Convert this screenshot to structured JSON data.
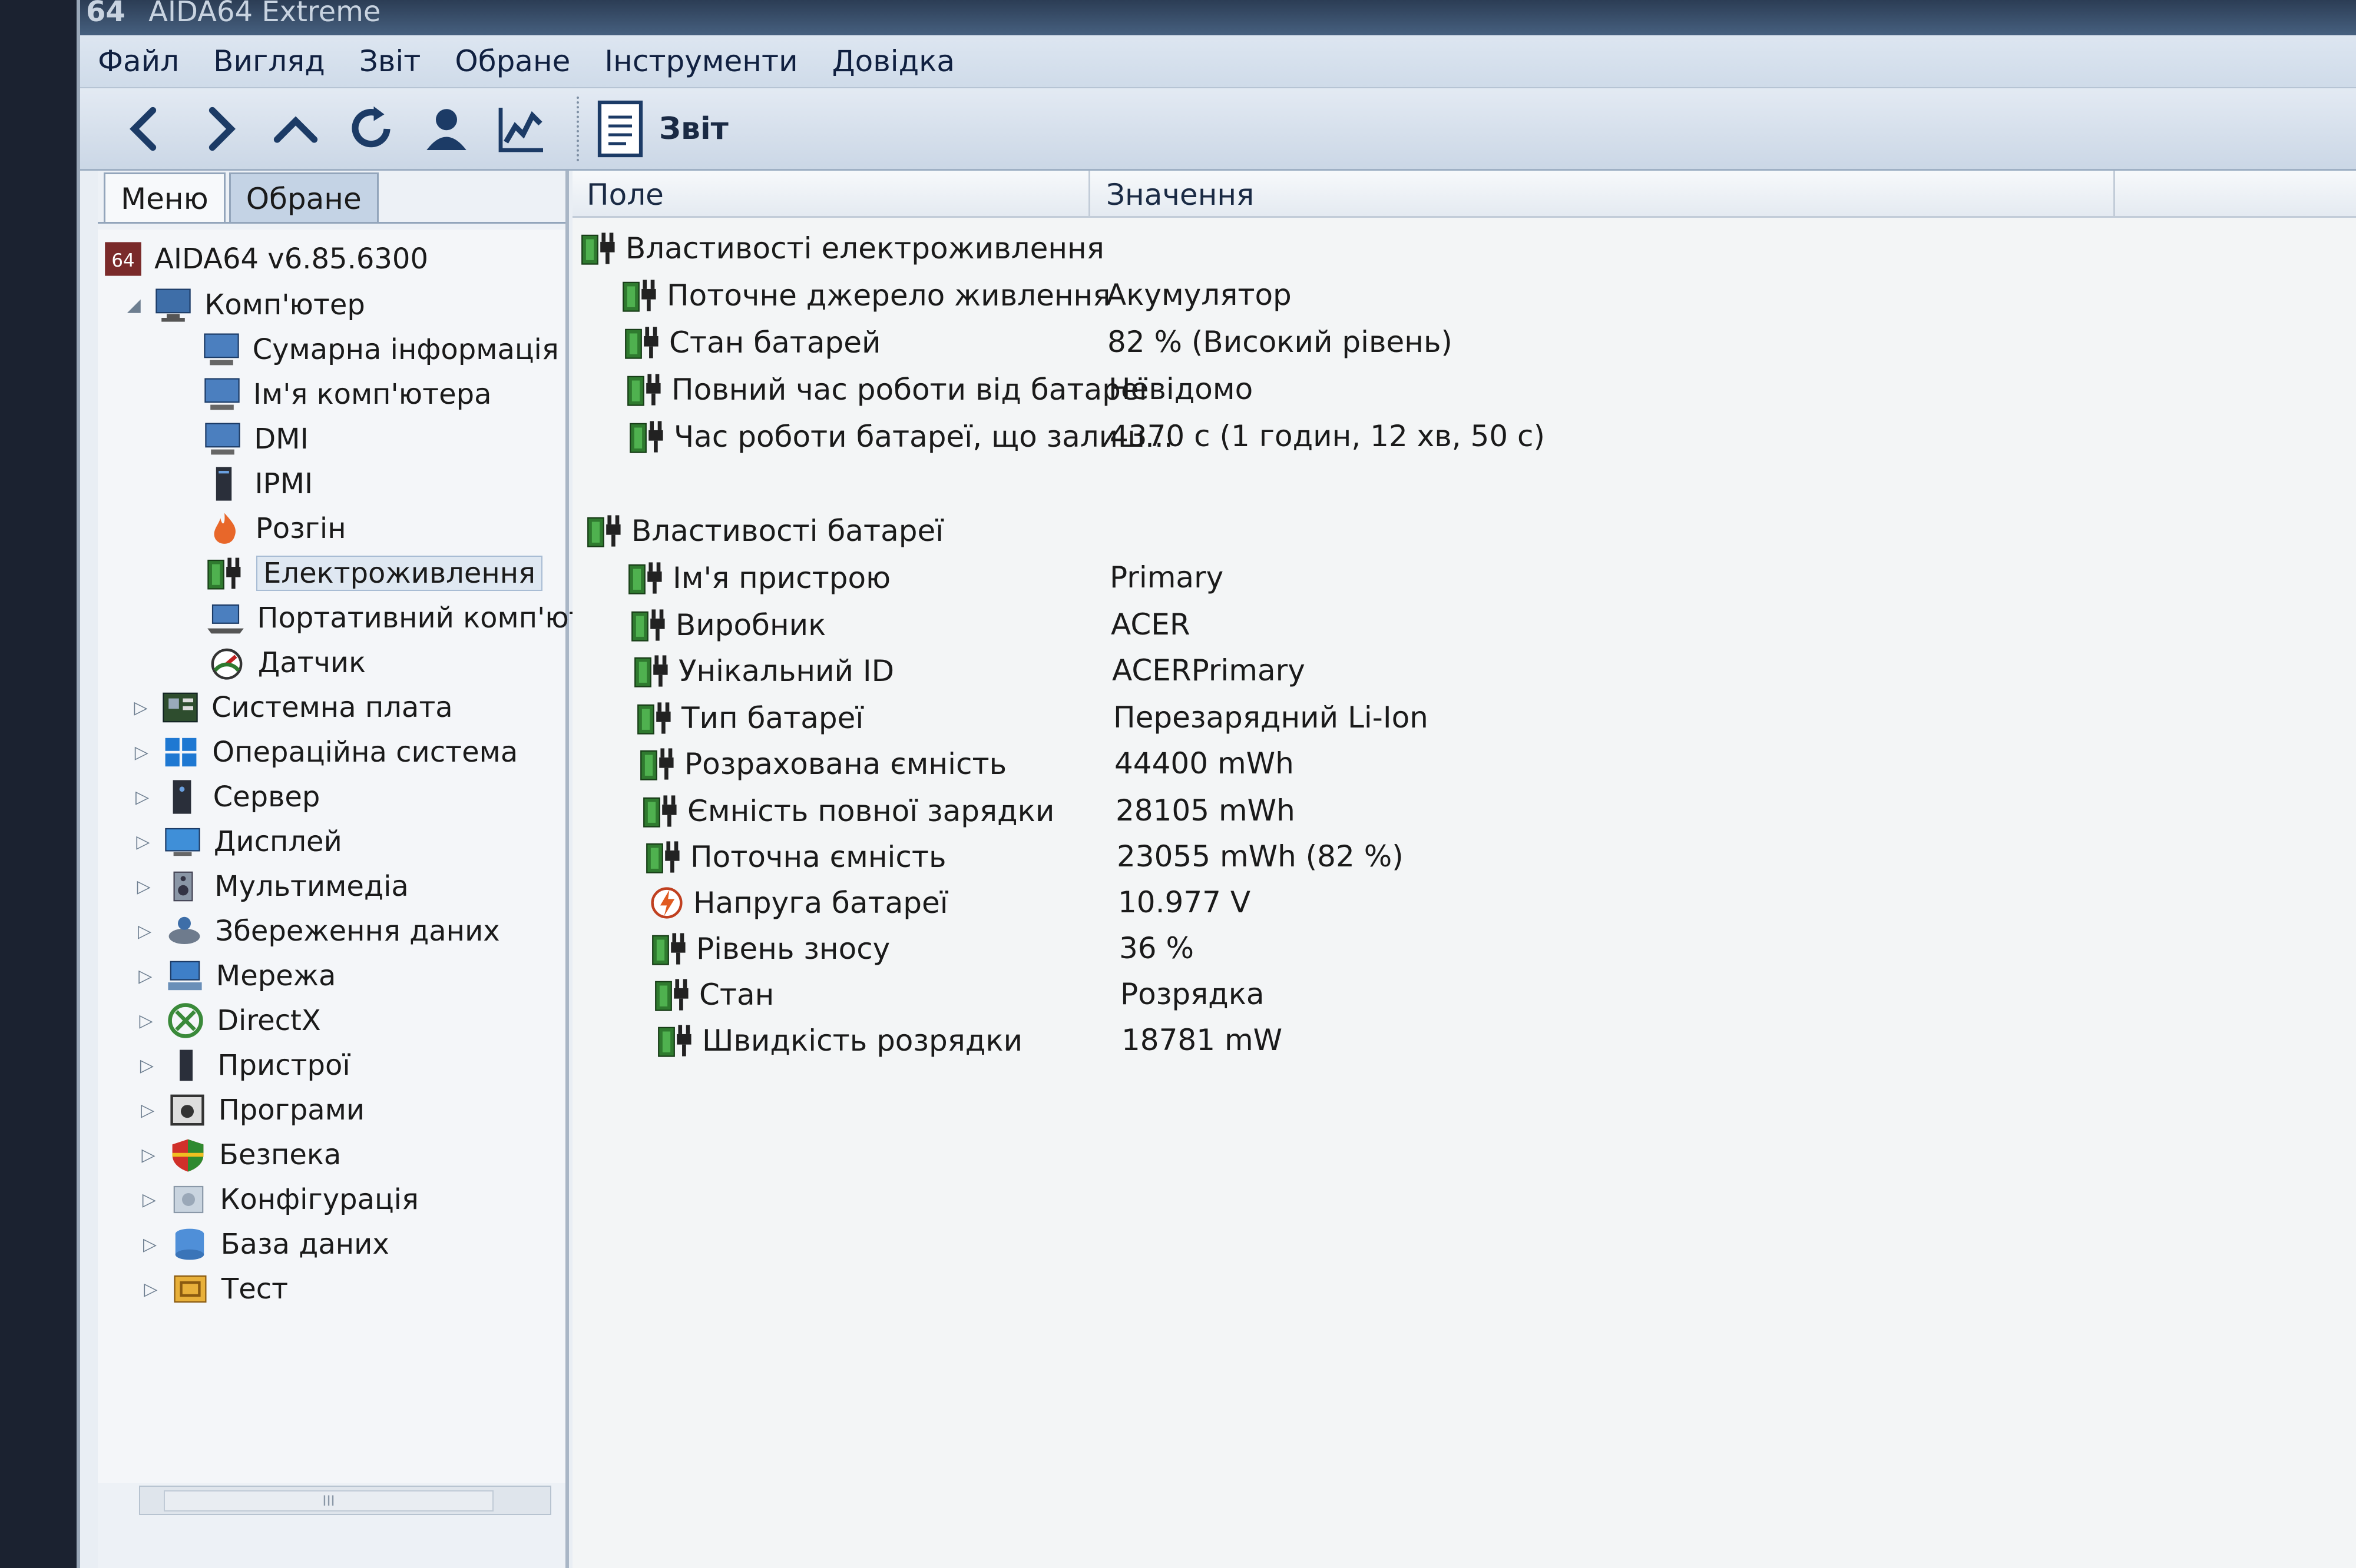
{
  "window": {
    "title_logo": "64",
    "title": "AIDA64 Extreme"
  },
  "menubar": [
    "Файл",
    "Вигляд",
    "Звіт",
    "Обране",
    "Інструменти",
    "Довідка"
  ],
  "toolbar": {
    "report_label": "Звіт"
  },
  "left_tabs": {
    "menu": "Меню",
    "favorites": "Обране"
  },
  "tree": [
    {
      "label": "AIDA64 v6.85.6300",
      "icon": "aida64-logo-icon",
      "level": 0,
      "expander": ""
    },
    {
      "label": "Комп'ютер",
      "icon": "computer-icon",
      "level": 1,
      "expander": "◢"
    },
    {
      "label": "Сумарна інформація",
      "icon": "monitor-icon",
      "level": 2,
      "expander": ""
    },
    {
      "label": "Ім'я комп'ютера",
      "icon": "monitor-icon",
      "level": 2,
      "expander": ""
    },
    {
      "label": "DMI",
      "icon": "monitor-icon",
      "level": 2,
      "expander": ""
    },
    {
      "label": "IPMI",
      "icon": "server-tower-icon",
      "level": 2,
      "expander": ""
    },
    {
      "label": "Розгін",
      "icon": "flame-icon",
      "level": 2,
      "expander": ""
    },
    {
      "label": "Електроживлення",
      "icon": "battery-plug-icon",
      "level": 2,
      "expander": "",
      "selected": true
    },
    {
      "label": "Портативний комп'ют",
      "icon": "laptop-icon",
      "level": 2,
      "expander": ""
    },
    {
      "label": "Датчик",
      "icon": "gauge-icon",
      "level": 2,
      "expander": ""
    },
    {
      "label": "Системна плата",
      "icon": "motherboard-icon",
      "level": 1,
      "expander": "▷"
    },
    {
      "label": "Операційна система",
      "icon": "windows-logo-icon",
      "level": 1,
      "expander": "▷"
    },
    {
      "label": "Сервер",
      "icon": "server-icon",
      "level": 1,
      "expander": "▷"
    },
    {
      "label": "Дисплей",
      "icon": "display-icon",
      "level": 1,
      "expander": "▷"
    },
    {
      "label": "Мультимедіа",
      "icon": "speaker-icon",
      "level": 1,
      "expander": "▷"
    },
    {
      "label": "Збереження даних",
      "icon": "storage-icon",
      "level": 1,
      "expander": "▷"
    },
    {
      "label": "Мережа",
      "icon": "network-icon",
      "level": 1,
      "expander": "▷"
    },
    {
      "label": "DirectX",
      "icon": "xbox-icon",
      "level": 1,
      "expander": "▷"
    },
    {
      "label": "Пристрої",
      "icon": "device-icon",
      "level": 1,
      "expander": "▷"
    },
    {
      "label": "Програми",
      "icon": "programs-icon",
      "level": 1,
      "expander": "▷"
    },
    {
      "label": "Безпека",
      "icon": "shield-icon",
      "level": 1,
      "expander": "▷"
    },
    {
      "label": "Конфігурація",
      "icon": "config-icon",
      "level": 1,
      "expander": "▷"
    },
    {
      "label": "База даних",
      "icon": "database-icon",
      "level": 1,
      "expander": "▷"
    },
    {
      "label": "Тест",
      "icon": "benchmark-icon",
      "level": 1,
      "expander": "▷"
    }
  ],
  "columns": {
    "field": "Поле",
    "value": "Значення"
  },
  "power_section": {
    "title": "Властивості електроживлення",
    "rows": [
      {
        "field": "Поточне джерело живлення",
        "value": "Акумулятор"
      },
      {
        "field": "Стан батарей",
        "value": "82 % (Високий рівень)"
      },
      {
        "field": "Повний час роботи від батареї",
        "value": "Невідомо"
      },
      {
        "field": "Час роботи батареї, що залиш...",
        "value": "4370 с (1 годин, 12 хв, 50 с)"
      }
    ]
  },
  "battery_section": {
    "title": "Властивості батареї",
    "rows": [
      {
        "field": "Ім'я пристрою",
        "value": "Primary"
      },
      {
        "field": "Виробник",
        "value": "ACER"
      },
      {
        "field": "Унікальний ID",
        "value": "ACERPrimary"
      },
      {
        "field": "Тип батареї",
        "value": "Перезарядний Li-Ion"
      },
      {
        "field": "Розрахована ємність",
        "value": "44400 mWh"
      },
      {
        "field": "Ємність повної зарядки",
        "value": "28105 mWh"
      },
      {
        "field": "Поточна ємність",
        "value": "23055 mWh  (82 %)"
      },
      {
        "field": "Напруга батареї",
        "value": "10.977 V",
        "icon": "voltage-icon"
      },
      {
        "field": "Рівень зносу",
        "value": "36 %"
      },
      {
        "field": "Стан",
        "value": "Розрядка"
      },
      {
        "field": "Швидкість розрядки",
        "value": "18781 mW"
      }
    ]
  },
  "scrollbar": {
    "thumb_grip": "III"
  }
}
